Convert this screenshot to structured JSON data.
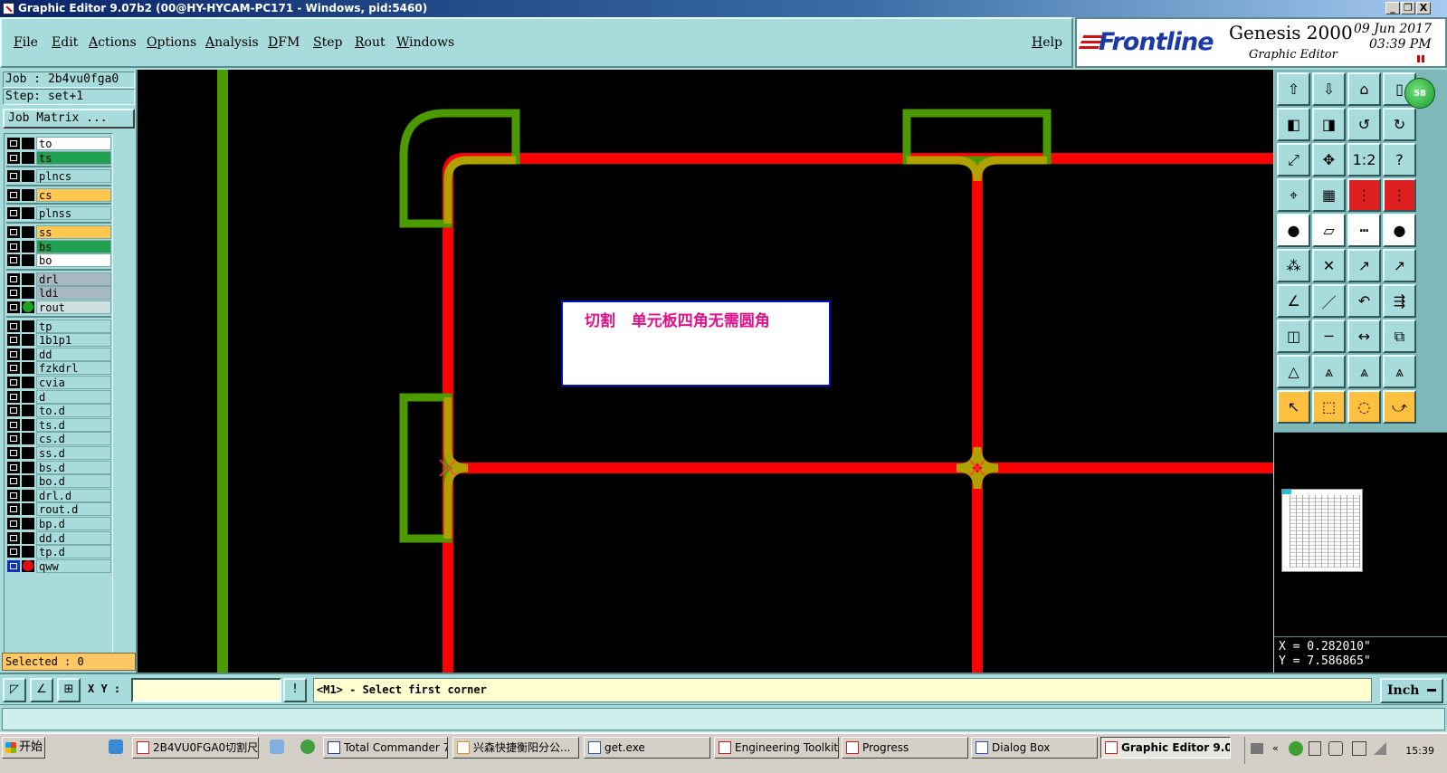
{
  "window": {
    "title": "Graphic Editor 9.07b2 (00@HY-HYCAM-PC171 - Windows, pid:5460)",
    "controls": [
      "_",
      "❐",
      "X"
    ]
  },
  "menu": {
    "items": [
      "File",
      "Edit",
      "Actions",
      "Options",
      "Analysis",
      "DFM",
      "Step",
      "Rout",
      "Windows"
    ],
    "help": "Help"
  },
  "brand": {
    "logo": "Frontline",
    "product": "Genesis 2000",
    "subtitle": "Graphic Editor",
    "date": "09 Jun 2017",
    "time": "03:39 PM"
  },
  "job": {
    "job_label": "Job : 2b4vu0fga0",
    "step_label": "Step: set+1",
    "matrix_button": "Job Matrix ..."
  },
  "layers": [
    {
      "name": "to",
      "color": "#ffffff",
      "group": 1
    },
    {
      "name": "ts",
      "color": "#20a050",
      "group": 1
    },
    {
      "name": "plncs",
      "color": "#a8dcdc",
      "group": 2
    },
    {
      "name": "cs",
      "color": "#ffc850",
      "group": 3
    },
    {
      "name": "plnss",
      "color": "#a8dcdc",
      "group": 4
    },
    {
      "name": "ss",
      "color": "#ffc850",
      "group": 5
    },
    {
      "name": "bs",
      "color": "#20a050",
      "group": 5
    },
    {
      "name": "bo",
      "color": "#ffffff",
      "group": 5
    },
    {
      "name": "drl",
      "color": "#a8b8c0",
      "group": 6
    },
    {
      "name": "ldi",
      "color": "#a8b8c0",
      "group": 6
    },
    {
      "name": "rout",
      "color": "#d0e0e0",
      "group": 6,
      "dot": "#20a020"
    },
    {
      "name": "tp",
      "color": "#a8dcdc",
      "group": 7
    },
    {
      "name": "1b1p1",
      "color": "#a8dcdc",
      "group": 7
    },
    {
      "name": "dd",
      "color": "#a8dcdc",
      "group": 7
    },
    {
      "name": "fzkdrl",
      "color": "#a8dcdc",
      "group": 7
    },
    {
      "name": "cvia",
      "color": "#a8dcdc",
      "group": 7
    },
    {
      "name": "d",
      "color": "#a8dcdc",
      "group": 7
    },
    {
      "name": "to.d",
      "color": "#a8dcdc",
      "group": 7
    },
    {
      "name": "ts.d",
      "color": "#a8dcdc",
      "group": 7
    },
    {
      "name": "cs.d",
      "color": "#a8dcdc",
      "group": 7
    },
    {
      "name": "ss.d",
      "color": "#a8dcdc",
      "group": 7
    },
    {
      "name": "bs.d",
      "color": "#a8dcdc",
      "group": 7
    },
    {
      "name": "bo.d",
      "color": "#a8dcdc",
      "group": 7
    },
    {
      "name": "drl.d",
      "color": "#a8dcdc",
      "group": 7
    },
    {
      "name": "rout.d",
      "color": "#a8dcdc",
      "group": 7
    },
    {
      "name": "bp.d",
      "color": "#a8dcdc",
      "group": 7
    },
    {
      "name": "dd.d",
      "color": "#a8dcdc",
      "group": 7
    },
    {
      "name": "tp.d",
      "color": "#a8dcdc",
      "group": 7
    },
    {
      "name": "qww",
      "color": "#a8dcdc",
      "group": 7,
      "dot": "#e01010",
      "active": true
    }
  ],
  "selected": "Selected : 0",
  "canvas": {
    "note": "切割   单元板四角无需圆角"
  },
  "badge": "58",
  "coords": {
    "x": "X = 0.282010\"",
    "y": "Y = 7.586865\""
  },
  "command": {
    "xy_label": "X Y :",
    "xy_value": "",
    "prompt": "<M1> - Select first corner",
    "units": "Inch"
  },
  "taskbar": {
    "start": "开始",
    "tasks": [
      "2B4VU0FGA0切割尺...",
      "Total Commander 7.0...",
      "兴森快捷衡阳分公...",
      "get.exe",
      "Engineering Toolkit 9....",
      "Progress",
      "Dialog Box",
      "Graphic Editor 9.07..."
    ],
    "active_task": "Graphic Editor 9.07...",
    "clock": "15:39"
  },
  "colors": {
    "panel": "#a8dcdc",
    "trace_red": "#ff0000",
    "trace_green": "#4a9a00",
    "trace_olive": "#b0a000",
    "note_text": "#e0108a"
  }
}
